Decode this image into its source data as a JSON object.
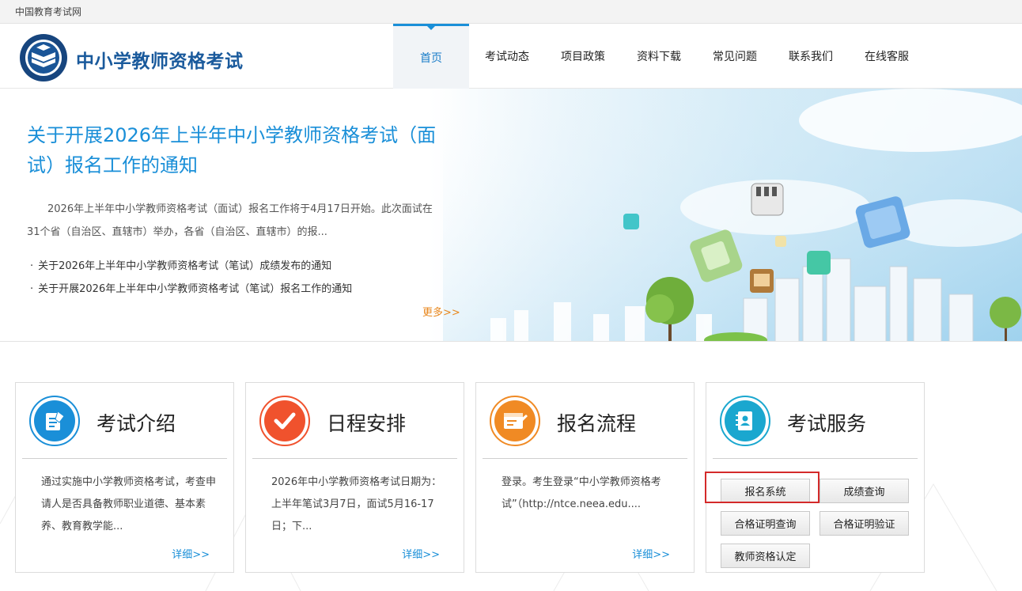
{
  "topbar": {
    "site_name": "中国教育考试网"
  },
  "header": {
    "brand": "中小学教师资格考试",
    "nav": [
      {
        "label": "首页",
        "active": true
      },
      {
        "label": "考试动态"
      },
      {
        "label": "项目政策"
      },
      {
        "label": "资料下载"
      },
      {
        "label": "常见问题"
      },
      {
        "label": "联系我们"
      },
      {
        "label": "在线客服"
      }
    ]
  },
  "banner": {
    "title": "关于开展2026年上半年中小学教师资格考试（面试）报名工作的通知",
    "desc": "2026年上半年中小学教师资格考试（面试）报名工作将于4月17日开始。此次面试在31个省（自治区、直辖市）举办，各省（自治区、直辖市）的报...",
    "list": [
      "关于2026年上半年中小学教师资格考试（笔试）成绩发布的通知",
      "关于开展2026年上半年中小学教师资格考试（笔试）报名工作的通知"
    ],
    "more": "更多>>"
  },
  "cards": [
    {
      "title": "考试介绍",
      "text": "通过实施中小学教师资格考试，考查申请人是否具备教师职业道德、基本素养、教育教学能...",
      "link": "详细>>",
      "color": "#1a8fd8"
    },
    {
      "title": "日程安排",
      "text": "2026年中小学教师资格考试日期为：上半年笔试3月7日，面试5月16-17日；下...",
      "link": "详细>>",
      "color": "#f0522d"
    },
    {
      "title": "报名流程",
      "text": "登录。考生登录“中小学教师资格考试”（http://ntce.neea.edu....",
      "link": "详细>>",
      "color": "#f08a24"
    },
    {
      "title": "考试服务",
      "color": "#1aa7cf",
      "buttons": [
        "报名系统",
        "成绩查询",
        "合格证明查询",
        "合格证明验证",
        "教师资格认定"
      ]
    }
  ],
  "icons": {
    "card1": "document-pen-icon",
    "card2": "checkmark-icon",
    "card3": "registration-form-icon",
    "card4": "contact-book-icon"
  }
}
